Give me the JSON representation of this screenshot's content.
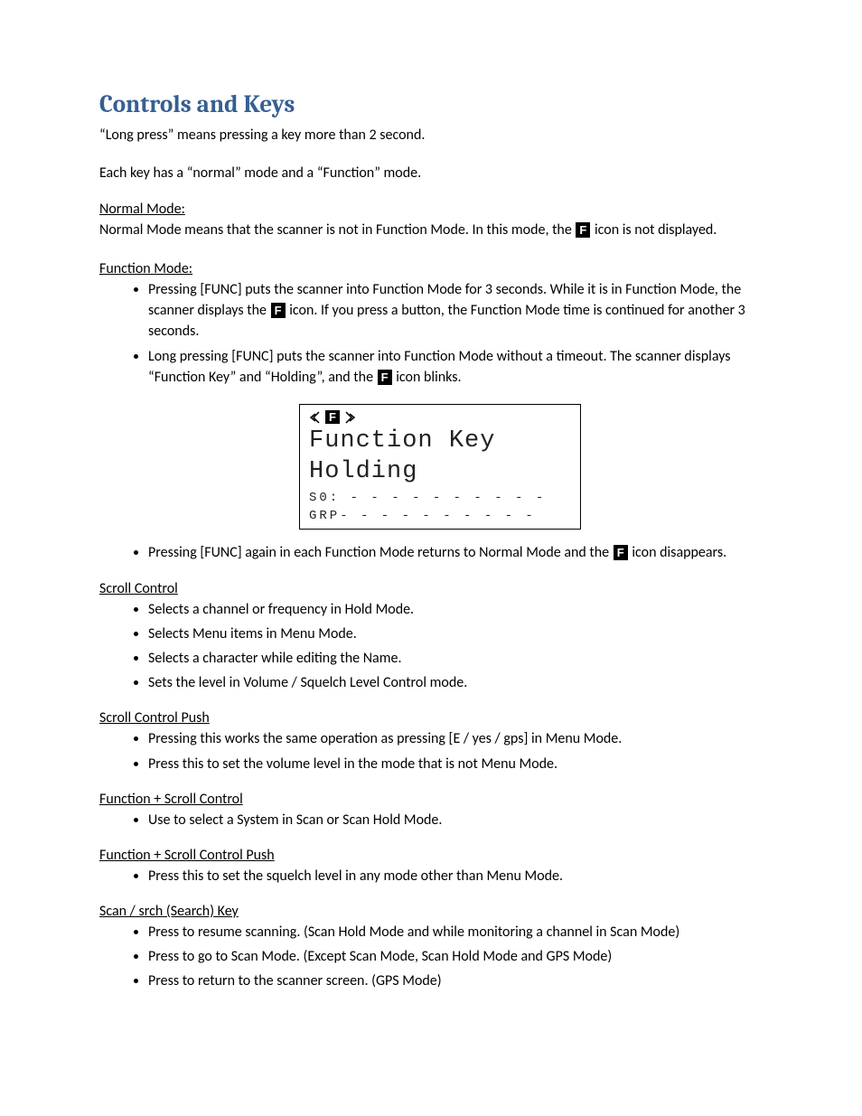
{
  "title": "Controls and Keys",
  "intro1": "“Long press” means pressing a key more than 2 second.",
  "intro2": "Each key has a “normal” mode and a “Function” mode.",
  "normalMode": {
    "heading": "Normal Mode:",
    "text_a": "Normal Mode means that the scanner is not in Function Mode. In this mode, the ",
    "icon": "F",
    "text_b": " icon is not displayed."
  },
  "functionMode": {
    "heading": "Function Mode:",
    "bullet1_a": "Pressing [FUNC] puts the scanner into Function Mode for 3 seconds. While it is in Function Mode, the scanner displays the ",
    "bullet1_icon": "F",
    "bullet1_b": " icon. If you press a button, the Function Mode time is continued for another 3 seconds.",
    "bullet2_a": "Long pressing [FUNC] puts the scanner into Function Mode without a timeout. The scanner displays “Function Key” and “Holding”, and the ",
    "bullet2_icon": "F",
    "bullet2_b": " icon blinks.",
    "bullet3_a": "Pressing [FUNC] again in each Function Mode returns to Normal Mode and the ",
    "bullet3_icon": "F",
    "bullet3_b": " icon disappears."
  },
  "lcd": {
    "f": "F",
    "line1": "Function Key",
    "line2": "Holding",
    "s0": "S0: - - - - - - - - - -",
    "grp": "GRP- - - - - - - - - -"
  },
  "scrollControl": {
    "heading": "Scroll Control",
    "items": [
      "Selects a channel or frequency in Hold Mode.",
      "Selects Menu items in Menu Mode.",
      "Selects a character while editing the Name.",
      "Sets the level in Volume / Squelch Level Control mode."
    ]
  },
  "scrollControlPush": {
    "heading": "Scroll Control Push",
    "items": [
      "Pressing this works the same operation as pressing [E / yes / gps] in Menu Mode.",
      "Press this to set the volume level in the mode that is not Menu Mode."
    ]
  },
  "functionScrollControl": {
    "heading": "Function + Scroll Control",
    "items": [
      "Use to select a System in Scan or Scan Hold Mode."
    ]
  },
  "functionScrollControlPush": {
    "heading": "Function + Scroll Control Push",
    "items": [
      "Press this to set the squelch level in any mode other than Menu Mode."
    ]
  },
  "scanSrchKey": {
    "heading": "Scan / srch (Search) Key",
    "items": [
      "Press to resume scanning. (Scan Hold Mode and while monitoring a channel in Scan Mode)",
      "Press to go to Scan Mode. (Except Scan Mode, Scan Hold Mode and GPS Mode)",
      "Press to return to the scanner screen. (GPS Mode)"
    ]
  }
}
